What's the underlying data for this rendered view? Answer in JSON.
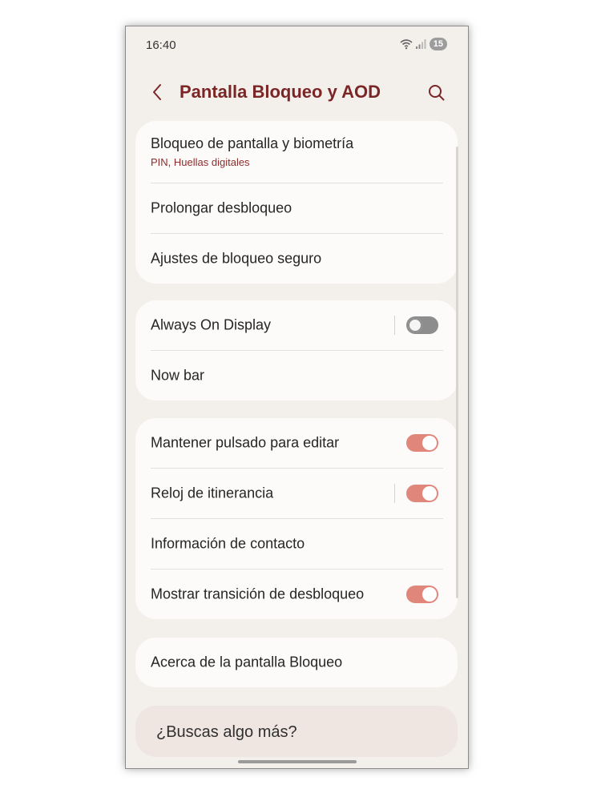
{
  "status_bar": {
    "time": "16:40",
    "battery": "15"
  },
  "header": {
    "title": "Pantalla Bloqueo y AOD"
  },
  "groups": {
    "security": {
      "lock": {
        "title": "Bloqueo de pantalla y biometría",
        "subtitle": "PIN, Huellas digitales"
      },
      "extend": {
        "title": "Prolongar desbloqueo"
      },
      "secure": {
        "title": "Ajustes de bloqueo seguro"
      }
    },
    "display": {
      "aod": {
        "title": "Always On Display",
        "toggle": false
      },
      "nowbar": {
        "title": "Now bar"
      }
    },
    "options": {
      "hold": {
        "title": "Mantener pulsado para editar",
        "toggle": true
      },
      "roaming": {
        "title": "Reloj de itinerancia",
        "toggle": true
      },
      "contact": {
        "title": "Información de contacto"
      },
      "transition": {
        "title": "Mostrar transición de desbloqueo",
        "toggle": true
      }
    },
    "about": {
      "title": "Acerca de la pantalla Bloqueo"
    }
  },
  "more": {
    "text": "¿Buscas algo más?"
  },
  "colors": {
    "accent": "#7a2626",
    "toggle_on": "#e0867a",
    "toggle_off": "#8d8d8d",
    "background": "#f3f0ec",
    "card": "#fdfbf9"
  }
}
